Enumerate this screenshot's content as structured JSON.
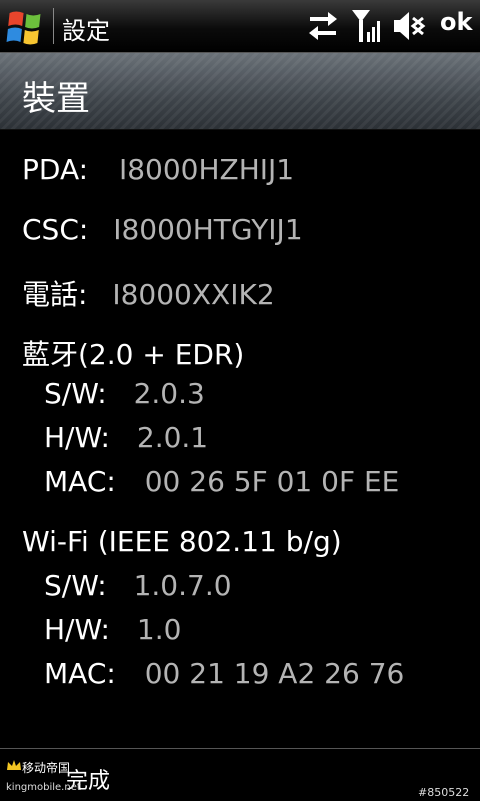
{
  "titlebar": {
    "app_title": "設定",
    "ok_label": "ok",
    "icons": [
      "windows-start-icon",
      "data-transfer-icon",
      "signal-strength-icon",
      "speaker-muted-icon"
    ]
  },
  "header": {
    "title": "裝置"
  },
  "info": {
    "pda": {
      "label": "PDA:",
      "value": "I8000HZHIJ1"
    },
    "csc": {
      "label": "CSC:",
      "value": "I8000HTGYIJ1"
    },
    "phone": {
      "label": "電話:",
      "value": "I8000XXIK2"
    }
  },
  "bluetooth": {
    "title": "藍牙(2.0 + EDR)",
    "sw": {
      "label": "S/W:",
      "value": "2.0.3"
    },
    "hw": {
      "label": "H/W:",
      "value": "2.0.1"
    },
    "mac": {
      "label": "MAC:",
      "value": "00 26 5F 01 0F EE"
    }
  },
  "wifi": {
    "title": "Wi-Fi (IEEE 802.11 b/g)",
    "sw": {
      "label": "S/W:",
      "value": "1.0.7.0"
    },
    "hw": {
      "label": "H/W:",
      "value": "1.0"
    },
    "mac": {
      "label": "MAC:",
      "value": "00 21 19 A2 26 76"
    }
  },
  "softbar": {
    "done_label": "完成",
    "watermark_text": "移动帝国",
    "watermark_url": "kingmobile.net",
    "watermark_id": "#850522"
  }
}
